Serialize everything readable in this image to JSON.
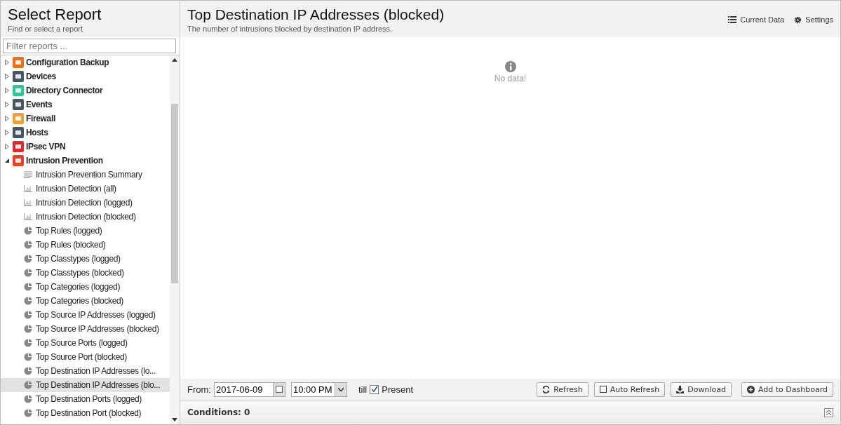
{
  "sidebar": {
    "title": "Select Report",
    "subtitle": "Find or select a report",
    "filter": {
      "placeholder": "Filter reports ..."
    },
    "categories": [
      {
        "label": "Configuration Backup",
        "color": "#e8731c",
        "expanded": false
      },
      {
        "label": "Devices",
        "color": "#4a5563",
        "expanded": false
      },
      {
        "label": "Directory Connector",
        "color": "#2fc59a",
        "expanded": false
      },
      {
        "label": "Events",
        "color": "#4a5563",
        "expanded": false
      },
      {
        "label": "Firewall",
        "color": "#f0a040",
        "expanded": false
      },
      {
        "label": "Hosts",
        "color": "#4a5563",
        "expanded": false
      },
      {
        "label": "IPsec VPN",
        "color": "#d92b2b",
        "expanded": false
      },
      {
        "label": "Intrusion Prevention",
        "color": "#e0432c",
        "expanded": true,
        "children": [
          {
            "label": "Intrusion Prevention Summary",
            "kind": "summary",
            "selected": false
          },
          {
            "label": "Intrusion Detection (all)",
            "kind": "bar",
            "selected": false
          },
          {
            "label": "Intrusion Detection (logged)",
            "kind": "bar",
            "selected": false
          },
          {
            "label": "Intrusion Detection (blocked)",
            "kind": "bar",
            "selected": false
          },
          {
            "label": "Top Rules (logged)",
            "kind": "pie",
            "selected": false
          },
          {
            "label": "Top Rules (blocked)",
            "kind": "pie",
            "selected": false
          },
          {
            "label": "Top Classtypes (logged)",
            "kind": "pie",
            "selected": false
          },
          {
            "label": "Top Classtypes (blocked)",
            "kind": "pie",
            "selected": false
          },
          {
            "label": "Top Categories (logged)",
            "kind": "pie",
            "selected": false
          },
          {
            "label": "Top Categories (blocked)",
            "kind": "pie",
            "selected": false
          },
          {
            "label": "Top Source IP Addresses (logged)",
            "kind": "pie",
            "selected": false
          },
          {
            "label": "Top Source IP Addresses (blocked)",
            "kind": "pie",
            "selected": false
          },
          {
            "label": "Top Source Ports (logged)",
            "kind": "pie",
            "selected": false
          },
          {
            "label": "Top Source Port (blocked)",
            "kind": "pie",
            "selected": false
          },
          {
            "label": "Top Destination IP Addresses (lo...",
            "kind": "pie",
            "selected": false
          },
          {
            "label": "Top Destination IP Addresses (blo...",
            "kind": "pie",
            "selected": true
          },
          {
            "label": "Top Destination Ports (logged)",
            "kind": "pie",
            "selected": false
          },
          {
            "label": "Top Destination Port (blocked)",
            "kind": "pie",
            "selected": false
          }
        ]
      }
    ]
  },
  "report": {
    "title": "Top Destination IP Addresses (blocked)",
    "description": "The number of intrusions blocked by destination IP address.",
    "actions": [
      {
        "label": "Current Data",
        "kind": "list"
      },
      {
        "label": "Settings",
        "kind": "gear"
      }
    ],
    "empty_message": "No data!"
  },
  "toolbar": {
    "from_label": "From:",
    "date": "2017-06-09",
    "time": "10:00 PM",
    "till_label": "till",
    "present": {
      "label": "Present",
      "checked": true
    },
    "buttons": [
      {
        "label": "Refresh",
        "kind": "refresh"
      },
      {
        "label": "Auto Refresh",
        "kind": "checkbox"
      },
      {
        "label": "Download",
        "kind": "download"
      },
      {
        "label": "Add to Dashboard",
        "kind": "add"
      }
    ]
  },
  "conditions": {
    "label": "Conditions: 0"
  }
}
